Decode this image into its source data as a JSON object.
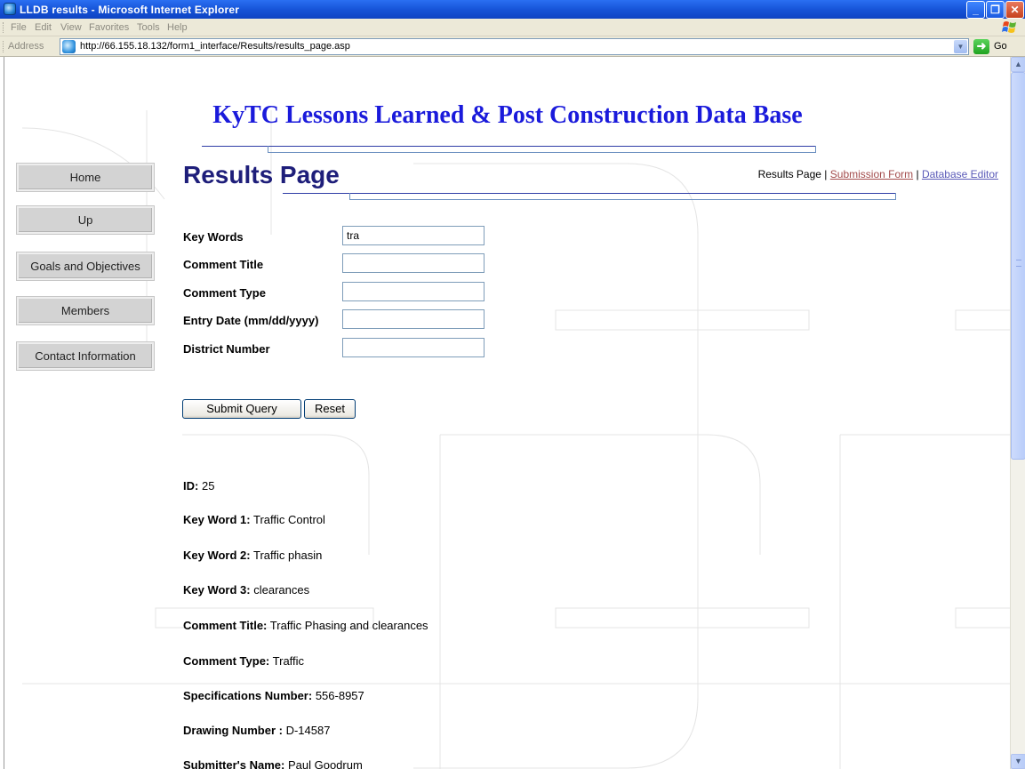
{
  "window": {
    "title": "LLDB results - Microsoft Internet Explorer",
    "minimize_glyph": "_",
    "maximize_glyph": "❐",
    "close_glyph": "✕"
  },
  "menubar": {
    "items": [
      "File",
      "Edit",
      "View",
      "Favorites",
      "Tools",
      "Help"
    ]
  },
  "addressbar": {
    "label": "Address",
    "url": "http://66.155.18.132/form1_interface/Results/results_page.asp",
    "go_label": "Go",
    "go_glyph": "➜",
    "dropdown_glyph": "▼"
  },
  "site": {
    "title": "KyTC Lessons Learned & Post Construction Data Base"
  },
  "page": {
    "heading": "Results Page",
    "nav_current": "Results Page",
    "nav_separator": "|",
    "nav_submission": "Submission Form",
    "nav_db_editor": "Database Editor"
  },
  "sidenav": {
    "items": [
      "Home",
      "Up",
      "Goals and Objectives",
      "Members",
      "Contact Information"
    ]
  },
  "form": {
    "labels": {
      "key_words": "Key Words",
      "comment_title": "Comment Title",
      "comment_type": "Comment Type",
      "entry_date": "Entry Date (mm/dd/yyyy)",
      "district_number": "District Number"
    },
    "values": {
      "key_words": "tra",
      "comment_title": "",
      "comment_type": "",
      "entry_date": "",
      "district_number": ""
    },
    "submit_label": "Submit Query",
    "reset_label": "Reset"
  },
  "record": {
    "id": {
      "label": "ID:",
      "value": "25"
    },
    "key_word_1": {
      "label": "Key Word 1:",
      "value": "Traffic Control"
    },
    "key_word_2": {
      "label": "Key Word 2:",
      "value": "Traffic phasin"
    },
    "key_word_3": {
      "label": "Key Word 3:",
      "value": "clearances"
    },
    "comment_title": {
      "label": "Comment Title:",
      "value": "Traffic Phasing and clearances"
    },
    "comment_type": {
      "label": "Comment Type:",
      "value": "Traffic"
    },
    "spec_number": {
      "label": "Specifications Number:",
      "value": "556-8957"
    },
    "drawing_number": {
      "label": "Drawing Number :",
      "value": "D-14587"
    },
    "submitter_name": {
      "label": "Submitter's Name:",
      "value": "Paul Goodrum"
    }
  },
  "scrollbar": {
    "up_glyph": "▲",
    "down_glyph": "▼"
  }
}
